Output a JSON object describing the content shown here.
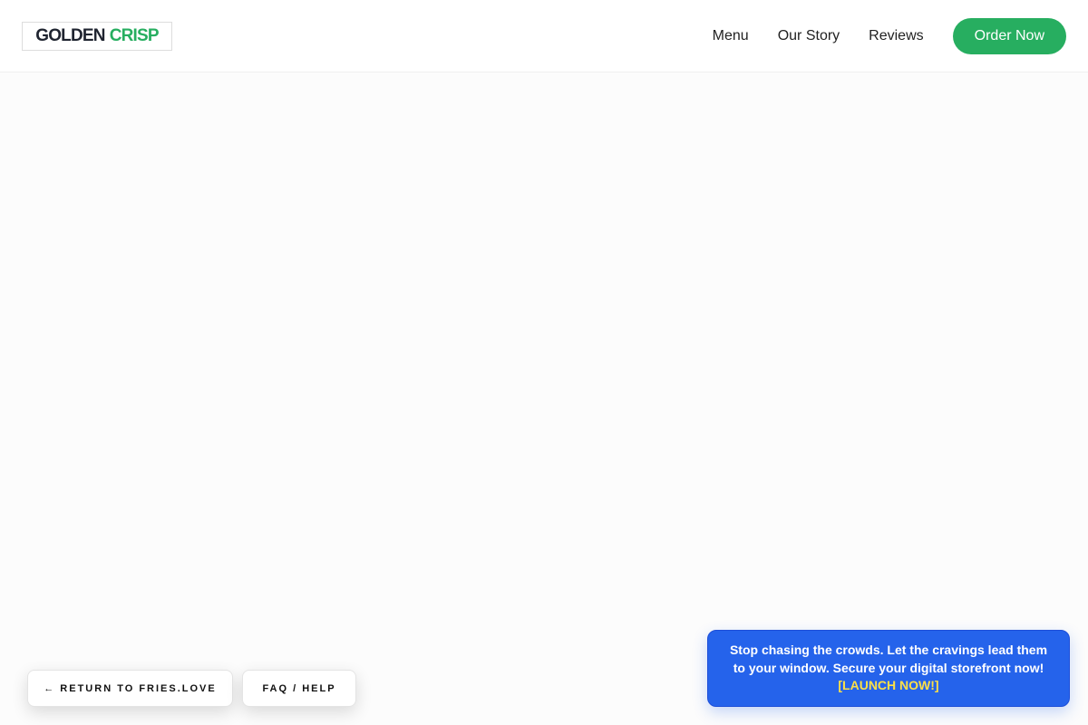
{
  "header": {
    "logo": {
      "part1": "GOLDEN",
      "part2": "CRISP"
    },
    "nav": [
      {
        "label": "Menu"
      },
      {
        "label": "Our Story"
      },
      {
        "label": "Reviews"
      }
    ],
    "cta_label": "Order Now"
  },
  "footer_buttons": {
    "return_label": "← RETURN TO FRIES.LOVE",
    "faq_label": "FAQ / HELP"
  },
  "promo": {
    "message": "Stop chasing the crowds. Let the cravings lead them to your window. Secure your digital storefront now!",
    "cta": "[LAUNCH NOW!]"
  },
  "colors": {
    "brand_green": "#27ae60",
    "promo_blue": "#2563eb",
    "promo_cta_yellow": "#fde047"
  }
}
